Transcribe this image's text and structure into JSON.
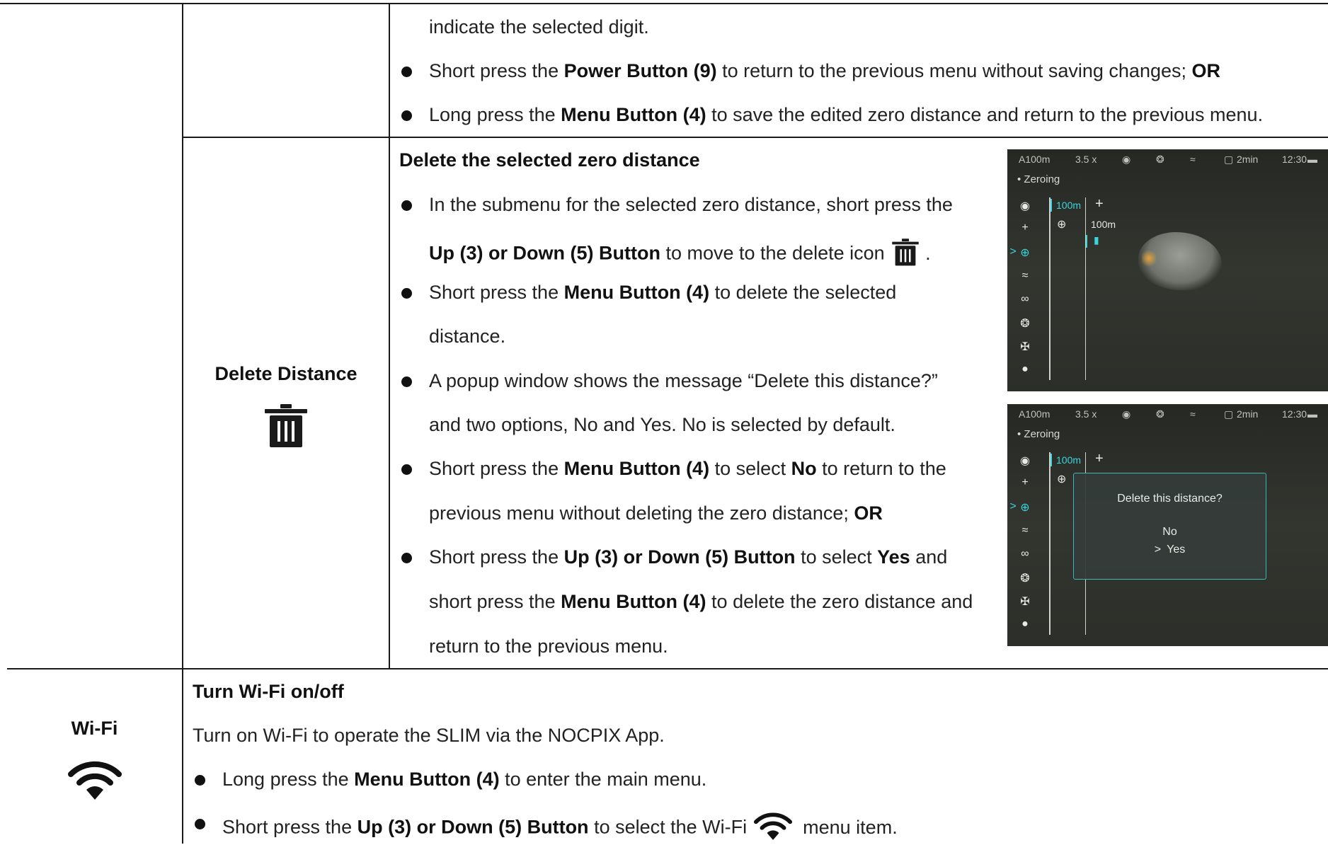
{
  "row1": {
    "continuation": "indicate the selected digit.",
    "bullets": [
      {
        "pre": "Short press the ",
        "b1": "Power Button (9)",
        "mid": " to return to the previous menu without saving changes; ",
        "b2": "OR"
      },
      {
        "pre": "Long press the ",
        "b1": "Menu Button (4)",
        "mid": " to save the edited zero distance and return to the previous menu."
      }
    ]
  },
  "delete_row": {
    "label": "Delete Distance",
    "label_icon": "trash-icon",
    "heading": "Delete the selected zero distance",
    "b1": {
      "l1_pre": "In the submenu for the selected zero distance, short press the",
      "l2_bold": "Up (3) or Down (5) Button",
      "l2_post": " to move to the delete icon",
      "l2_end": "."
    },
    "b2": {
      "l1_pre": "Short press the ",
      "l1_bold": "Menu Button (4)",
      "l1_post": " to delete the selected",
      "l2": "distance."
    },
    "b3": {
      "l1": "A popup window shows the message “Delete this distance?”",
      "l2": "and two options, No and Yes. No is selected by default."
    },
    "b4": {
      "l1_pre": "Short press the ",
      "l1_bold": "Menu Button (4)",
      "l1_mid": " to select ",
      "l1_bold2": "No",
      "l1_post": " to return to the",
      "l2_pre": "previous menu without deleting the zero distance; ",
      "l2_bold": "OR"
    },
    "b5": {
      "l1_pre": "Short press the ",
      "l1_bold": "Up (3) or Down (5) Button",
      "l1_mid": " to select ",
      "l1_bold2": "Yes",
      "l1_post": " and",
      "l2_pre": "short press the ",
      "l2_bold": "Menu Button (4)",
      "l2_post": " to delete the zero distance and",
      "l3": "return to the previous menu."
    }
  },
  "screens": {
    "status": {
      "profile": "A100m",
      "zoom": "3.5 x",
      "timer": "2min",
      "clock": "12:30"
    },
    "menu_title": "• Zeroing",
    "dist_selected": "100m",
    "dist_value": "100m",
    "popup": {
      "message": "Delete this distance?",
      "no": "No",
      "yes": "Yes",
      "yes_marker": ">"
    },
    "selection_marker": ">",
    "side_icons": [
      "eye-icon",
      "crosshair-icon",
      "target-icon",
      "wifi-icon",
      "link-icon",
      "shutter-icon",
      "fan-icon",
      "mic-icon"
    ]
  },
  "wifi_row": {
    "label": "Wi-Fi",
    "label_icon": "wifi-icon",
    "heading": "Turn Wi-Fi on/off",
    "intro": "Turn on Wi-Fi to operate the SLIM via the NOCPIX App.",
    "b1": {
      "pre": "Long press the ",
      "bold": "Menu Button (4)",
      "post": " to enter the main menu."
    },
    "b2": {
      "pre": "Short press the ",
      "bold": "Up (3) or Down (5) Button",
      "post": " to select the Wi-Fi",
      "end": " menu item."
    }
  },
  "colors": {
    "accent": "#39d4dc",
    "text": "#222222",
    "rule": "#1a1a1a"
  }
}
